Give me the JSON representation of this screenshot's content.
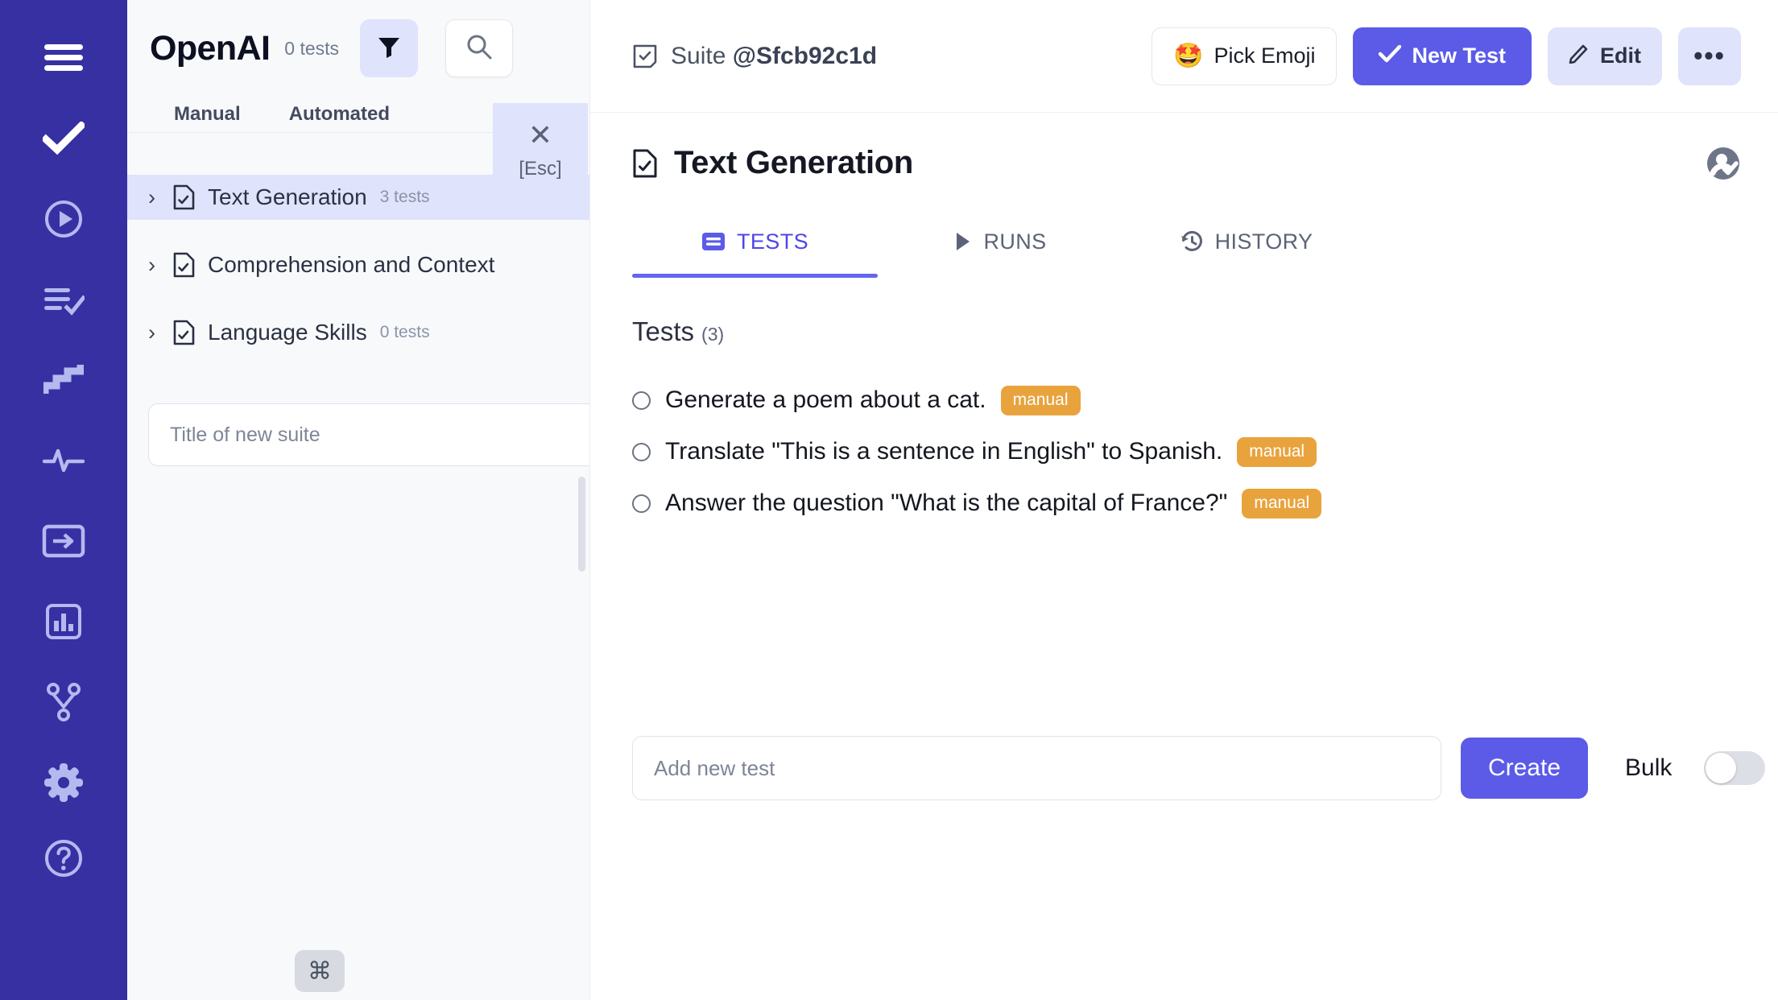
{
  "rail": {
    "items": [
      {
        "name": "menu-icon",
        "label": "Menu"
      },
      {
        "name": "check-icon",
        "label": "Tests"
      },
      {
        "name": "play-circle-icon",
        "label": "Runs"
      },
      {
        "name": "list-check-icon",
        "label": "Results"
      },
      {
        "name": "stairs-icon",
        "label": "Steps"
      },
      {
        "name": "activity-pulse-icon",
        "label": "Activity"
      },
      {
        "name": "login-box-icon",
        "label": "Integrations"
      },
      {
        "name": "bar-chart-icon",
        "label": "Analytics"
      },
      {
        "name": "git-branch-icon",
        "label": "Branches"
      },
      {
        "name": "gear-icon",
        "label": "Settings"
      },
      {
        "name": "help-circle-icon",
        "label": "Help"
      }
    ]
  },
  "left_panel": {
    "brand": "OpenAI",
    "count_label": "0 tests",
    "filter_icon": "funnel-icon",
    "search_icon": "search-icon",
    "tabs": [
      {
        "label": "Manual",
        "active": false
      },
      {
        "label": "Automated",
        "active": false
      }
    ],
    "suites": [
      {
        "name": "Text Generation",
        "count": "3 tests",
        "selected": true
      },
      {
        "name": "Comprehension and Context",
        "count": "",
        "selected": false
      },
      {
        "name": "Language Skills",
        "count": "0 tests",
        "selected": false
      }
    ],
    "new_suite_placeholder": "Title of new suite",
    "new_suite_value": "",
    "command_key": "⌘"
  },
  "esc_overlay": {
    "close_icon": "close-icon",
    "label": "[Esc]"
  },
  "main": {
    "header": {
      "suite_icon": "suite-check-icon",
      "suite_prefix": "Suite ",
      "suite_handle": "@Sfcb92c1d",
      "pick_emoji_label": "Pick Emoji",
      "pick_emoji_glyph": "🤩",
      "new_test_label": "New Test",
      "edit_label": "Edit",
      "more_label": "•••"
    },
    "title": "Text Generation",
    "title_icon": "document-check-icon",
    "avatar_icon": "account-verified-icon",
    "tabs": [
      {
        "label": "TESTS",
        "icon": "tests-card-icon",
        "active": true
      },
      {
        "label": "RUNS",
        "icon": "play-triangle-icon",
        "active": false
      },
      {
        "label": "HISTORY",
        "icon": "history-clock-icon",
        "active": false
      }
    ],
    "tests_heading": "Tests",
    "tests_count": "(3)",
    "tests": [
      {
        "text": "Generate a poem about a cat.",
        "tag": "manual"
      },
      {
        "text": "Translate \"This is a sentence in English\" to Spanish.",
        "tag": "manual"
      },
      {
        "text": "Answer the question \"What is the capital of France?\"",
        "tag": "manual"
      }
    ],
    "add_test_placeholder": "Add new test",
    "add_test_value": "",
    "create_label": "Create",
    "bulk_label": "Bulk",
    "bulk_on": false
  },
  "colors": {
    "rail_bg": "#3730a3",
    "rail_icon": "#b4b9ef",
    "accent": "#5b5be8",
    "accent_soft": "#dfe3fb",
    "tab_active": "#4f46e5",
    "tag_manual": "#e8a33d",
    "annotation_arrow": "#ee4444",
    "left_panel_bg": "#f8f9fb"
  }
}
